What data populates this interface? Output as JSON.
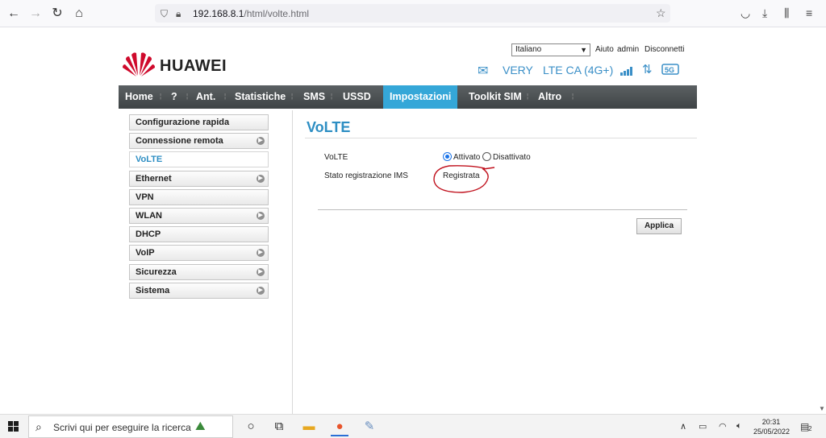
{
  "browser": {
    "url_host": "192.168.8.1",
    "url_path": "/html/volte.html",
    "icons": [
      "back-arrow-icon",
      "forward-arrow-icon",
      "reload-icon",
      "home-icon",
      "shield-icon",
      "lock-icon",
      "bookmark-star-icon",
      "pocket-icon",
      "download-icon",
      "library-icon",
      "menu-icon"
    ]
  },
  "header": {
    "language": "Italiano",
    "links": [
      "Aiuto",
      "admin",
      "Disconnetti"
    ],
    "brand": "HUAWEI",
    "operator": "VERY",
    "network": "LTE CA (4G+)"
  },
  "menu": {
    "items": [
      "Home",
      "?",
      "Ant.",
      "Statistiche",
      "SMS",
      "USSD",
      "Impostazioni",
      "Toolkit SIM",
      "Altro"
    ],
    "active": "Impostazioni"
  },
  "sidebar": {
    "items": [
      {
        "label": "Configurazione rapida",
        "arrow": false
      },
      {
        "label": "Connessione remota",
        "arrow": true
      },
      {
        "label": "VoLTE",
        "arrow": false
      },
      {
        "label": "Ethernet",
        "arrow": true
      },
      {
        "label": "VPN",
        "arrow": false
      },
      {
        "label": "WLAN",
        "arrow": true
      },
      {
        "label": "DHCP",
        "arrow": false
      },
      {
        "label": "VoIP",
        "arrow": true
      },
      {
        "label": "Sicurezza",
        "arrow": true
      },
      {
        "label": "Sistema",
        "arrow": true
      }
    ],
    "active": "VoLTE"
  },
  "content": {
    "title": "VoLTE",
    "volte_label": "VoLTE",
    "option_on": "Attivato",
    "option_off": "Disattivato",
    "selected": "Attivato",
    "ims_label": "Stato registrazione IMS",
    "ims_value": "Registrata",
    "apply": "Applica",
    "annotation_color": "#c0101c"
  },
  "taskbar": {
    "search_placeholder": "Scrivi qui per eseguire la ricerca",
    "time": "20:31",
    "date": "25/05/2022",
    "notifications": "2"
  },
  "colors": {
    "accent": "#35a7d8",
    "title": "#2d8ec3",
    "menubar": "#4a4f51"
  }
}
